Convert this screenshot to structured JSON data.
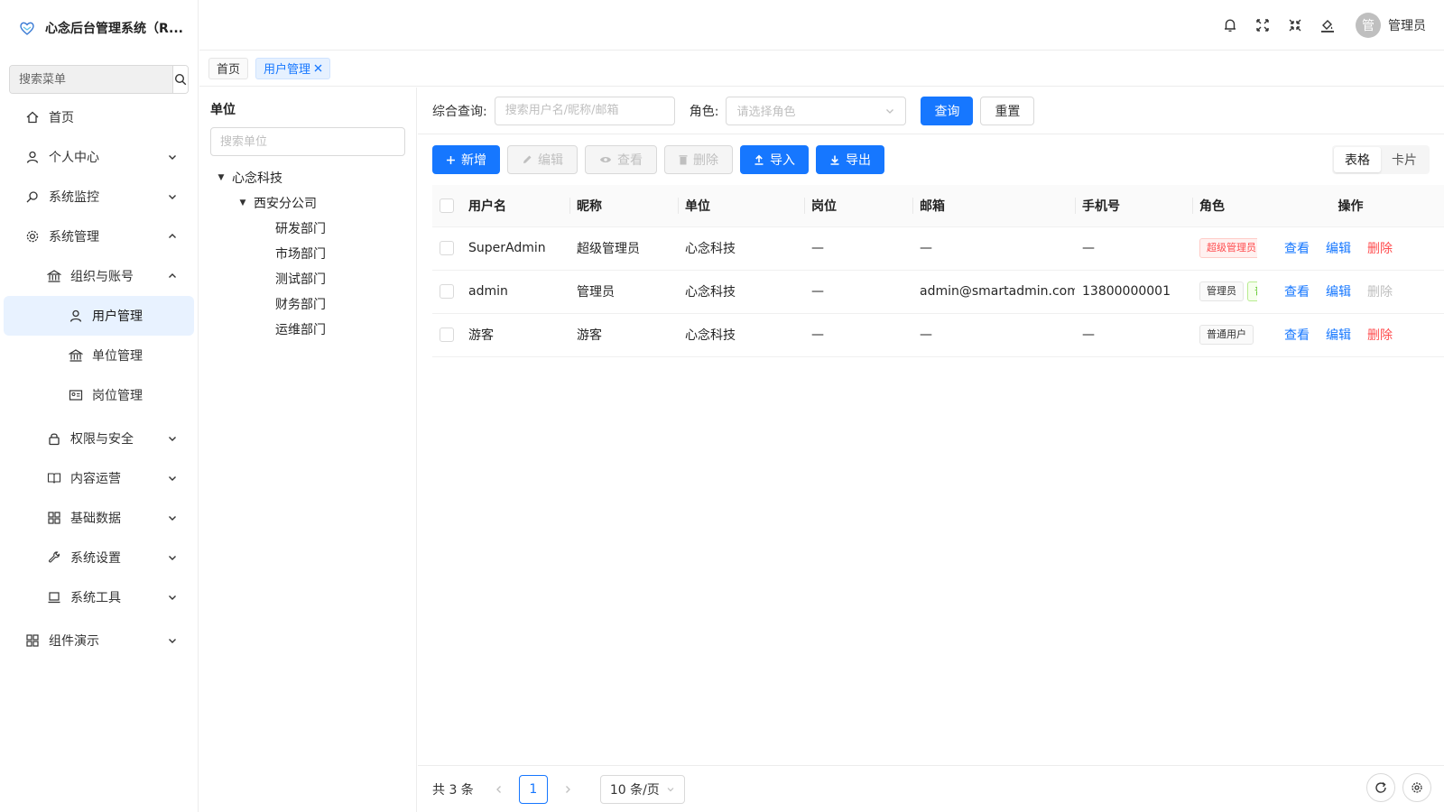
{
  "brand": {
    "title": "心念后台管理系统（R..."
  },
  "menu_search": {
    "placeholder": "搜索菜单"
  },
  "menu": {
    "home": "首页",
    "personal": "个人中心",
    "monitor": "系统监控",
    "system": "系统管理",
    "org": "组织与账号",
    "users": "用户管理",
    "units": "单位管理",
    "posts": "岗位管理",
    "security": "权限与安全",
    "content": "内容运营",
    "basic": "基础数据",
    "settings": "系统设置",
    "tools": "系统工具",
    "demo": "组件演示"
  },
  "header": {
    "avatar_char": "管",
    "username": "管理员"
  },
  "tabs": {
    "home": "首页",
    "users": "用户管理"
  },
  "tree": {
    "title": "单位",
    "search_placeholder": "搜索单位",
    "nodes": [
      "心念科技",
      "西安分公司",
      "研发部门",
      "市场部门",
      "测试部门",
      "财务部门",
      "运维部门"
    ]
  },
  "query": {
    "keyword_label": "综合查询:",
    "keyword_placeholder": "搜索用户名/昵称/邮箱",
    "role_label": "角色:",
    "role_placeholder": "请选择角色",
    "search_btn": "查询",
    "reset_btn": "重置"
  },
  "toolbar": {
    "add": "新增",
    "edit": "编辑",
    "view": "查看",
    "delete": "删除",
    "import": "导入",
    "export": "导出",
    "view_table": "表格",
    "view_card": "卡片"
  },
  "table": {
    "columns": [
      "用户名",
      "昵称",
      "单位",
      "岗位",
      "邮箱",
      "手机号",
      "角色",
      "操作"
    ],
    "rows": [
      {
        "username": "SuperAdmin",
        "nickname": "超级管理员",
        "unit": "心念科技",
        "post": "—",
        "email": "—",
        "phone": "—",
        "role1": "超级管理员",
        "role2": ""
      },
      {
        "username": "admin",
        "nickname": "管理员",
        "unit": "心念科技",
        "post": "—",
        "email": "admin@smartadmin.com",
        "phone": "13800000001",
        "role1": "管理员",
        "role2": "普"
      },
      {
        "username": "游客",
        "nickname": "游客",
        "unit": "心念科技",
        "post": "—",
        "email": "—",
        "phone": "—",
        "role1": "普通用户",
        "role2": ""
      }
    ],
    "op_view": "查看",
    "op_edit": "编辑",
    "op_delete": "删除"
  },
  "pagination": {
    "total": "共 3 条",
    "current": "1",
    "page_size": "10 条/页"
  },
  "colors": {
    "primary": "#1677ff",
    "danger": "#ff4d4f",
    "active_bg": "#e8f2ff"
  }
}
